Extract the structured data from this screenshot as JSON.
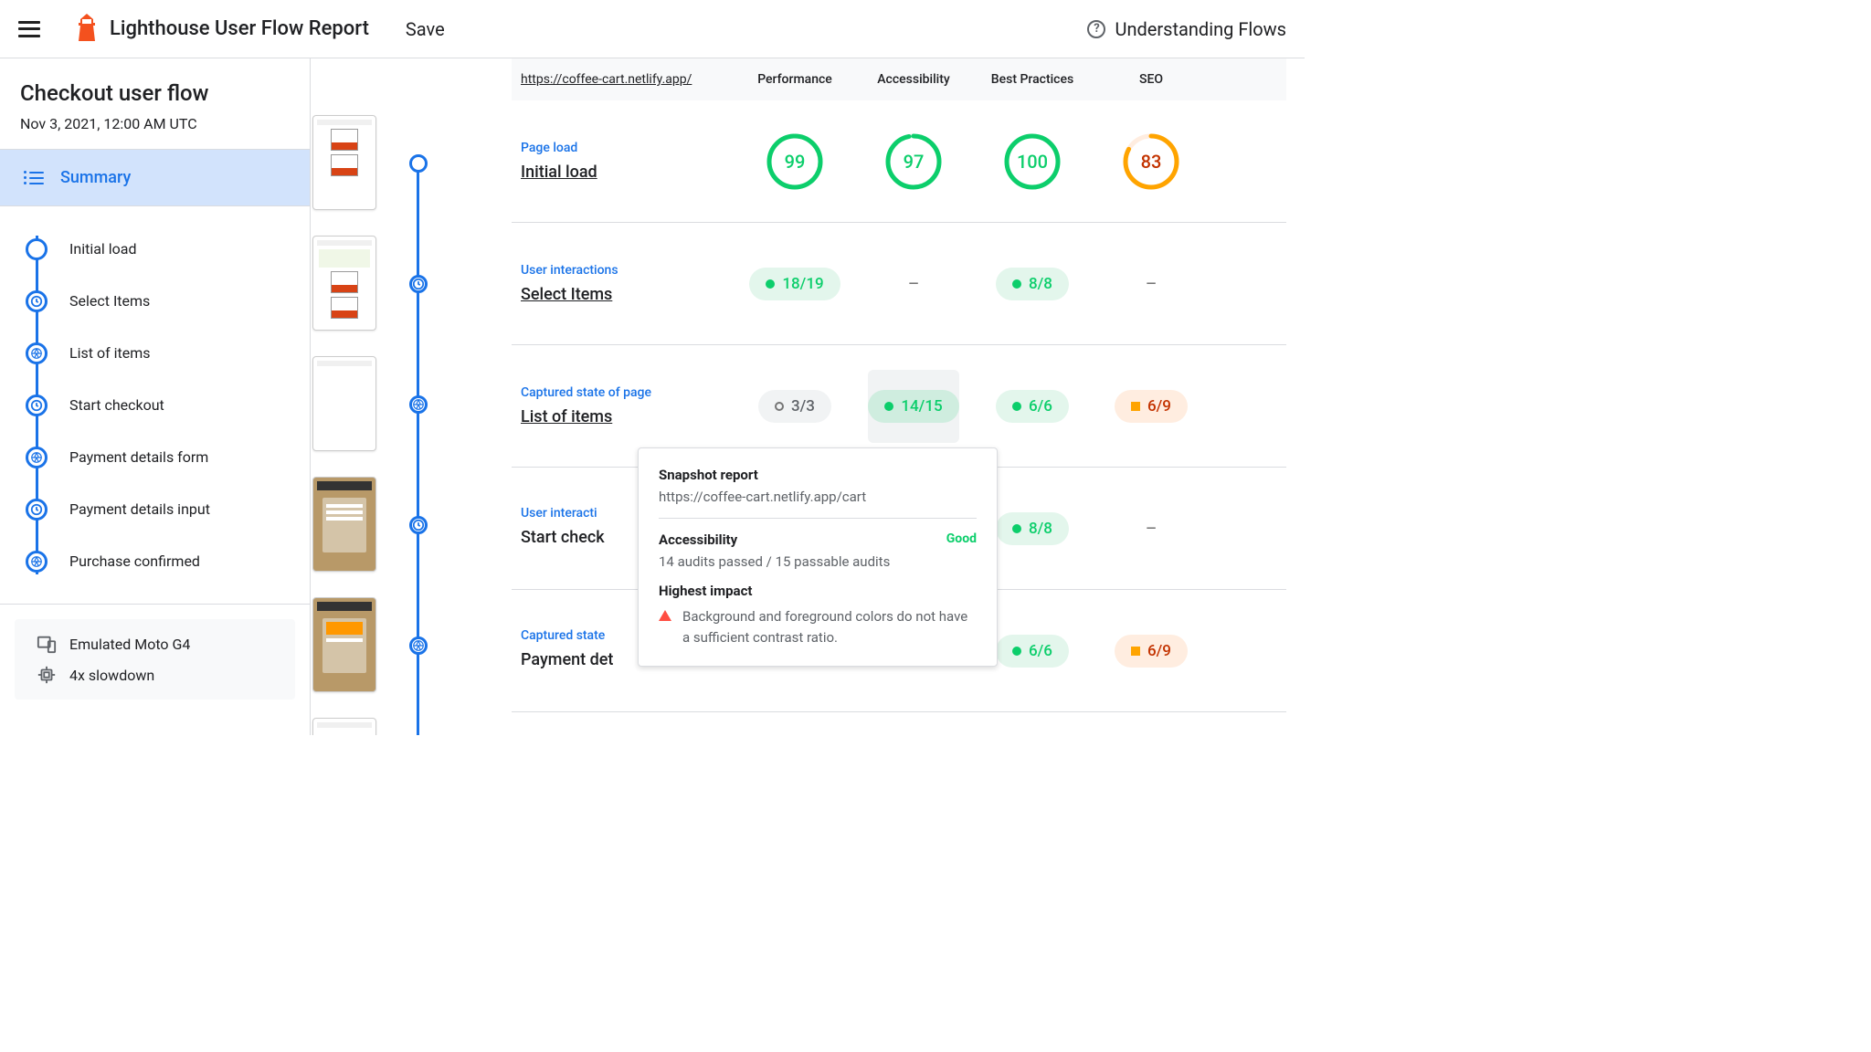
{
  "header": {
    "title": "Lighthouse User Flow Report",
    "save": "Save",
    "help": "Understanding Flows"
  },
  "sidebar": {
    "flow_title": "Checkout user flow",
    "flow_date": "Nov 3, 2021, 12:00 AM UTC",
    "summary": "Summary",
    "steps": [
      {
        "label": "Initial load",
        "icon": "circle"
      },
      {
        "label": "Select Items",
        "icon": "clock"
      },
      {
        "label": "List of items",
        "icon": "aperture"
      },
      {
        "label": "Start checkout",
        "icon": "clock"
      },
      {
        "label": "Payment details form",
        "icon": "aperture"
      },
      {
        "label": "Payment details input",
        "icon": "clock"
      },
      {
        "label": "Purchase confirmed",
        "icon": "aperture"
      }
    ],
    "env": {
      "device": "Emulated Moto G4",
      "throttle": "4x slowdown"
    }
  },
  "report": {
    "url": "https://coffee-cart.netlify.app/",
    "columns": [
      "Performance",
      "Accessibility",
      "Best Practices",
      "SEO"
    ],
    "rows": [
      {
        "type": "Page load",
        "name": "Initial load",
        "cells": [
          {
            "kind": "gauge",
            "value": 99,
            "color": "green"
          },
          {
            "kind": "gauge",
            "value": 97,
            "color": "green"
          },
          {
            "kind": "gauge",
            "value": 100,
            "color": "green"
          },
          {
            "kind": "gauge",
            "value": 83,
            "color": "orange"
          }
        ]
      },
      {
        "type": "User interactions",
        "name": "Select Items",
        "cells": [
          {
            "kind": "pill",
            "value": "18/19",
            "color": "green"
          },
          {
            "kind": "dash"
          },
          {
            "kind": "pill",
            "value": "8/8",
            "color": "green"
          },
          {
            "kind": "dash"
          }
        ]
      },
      {
        "type": "Captured state of page",
        "name": "List of items",
        "cells": [
          {
            "kind": "pill",
            "value": "3/3",
            "color": "neutral"
          },
          {
            "kind": "pill",
            "value": "14/15",
            "color": "green",
            "highlight": true
          },
          {
            "kind": "pill",
            "value": "6/6",
            "color": "green"
          },
          {
            "kind": "pill",
            "value": "6/9",
            "color": "orange"
          }
        ]
      },
      {
        "type": "User interactions",
        "name": "Start checkout",
        "cells": [
          null,
          null,
          {
            "kind": "pill",
            "value": "8/8",
            "color": "green"
          },
          {
            "kind": "dash"
          }
        ]
      },
      {
        "type": "Captured state of page",
        "name": "Payment details form",
        "cells": [
          null,
          null,
          {
            "kind": "pill",
            "value": "6/6",
            "color": "green"
          },
          {
            "kind": "pill",
            "value": "6/9",
            "color": "orange"
          }
        ]
      }
    ]
  },
  "popover": {
    "title": "Snapshot report",
    "url": "https://coffee-cart.netlify.app/cart",
    "category": "Accessibility",
    "status": "Good",
    "subtitle": "14 audits passed / 15 passable audits",
    "impact_title": "Highest impact",
    "impact_text": "Background and foreground colors do not have a sufficient contrast ratio."
  }
}
